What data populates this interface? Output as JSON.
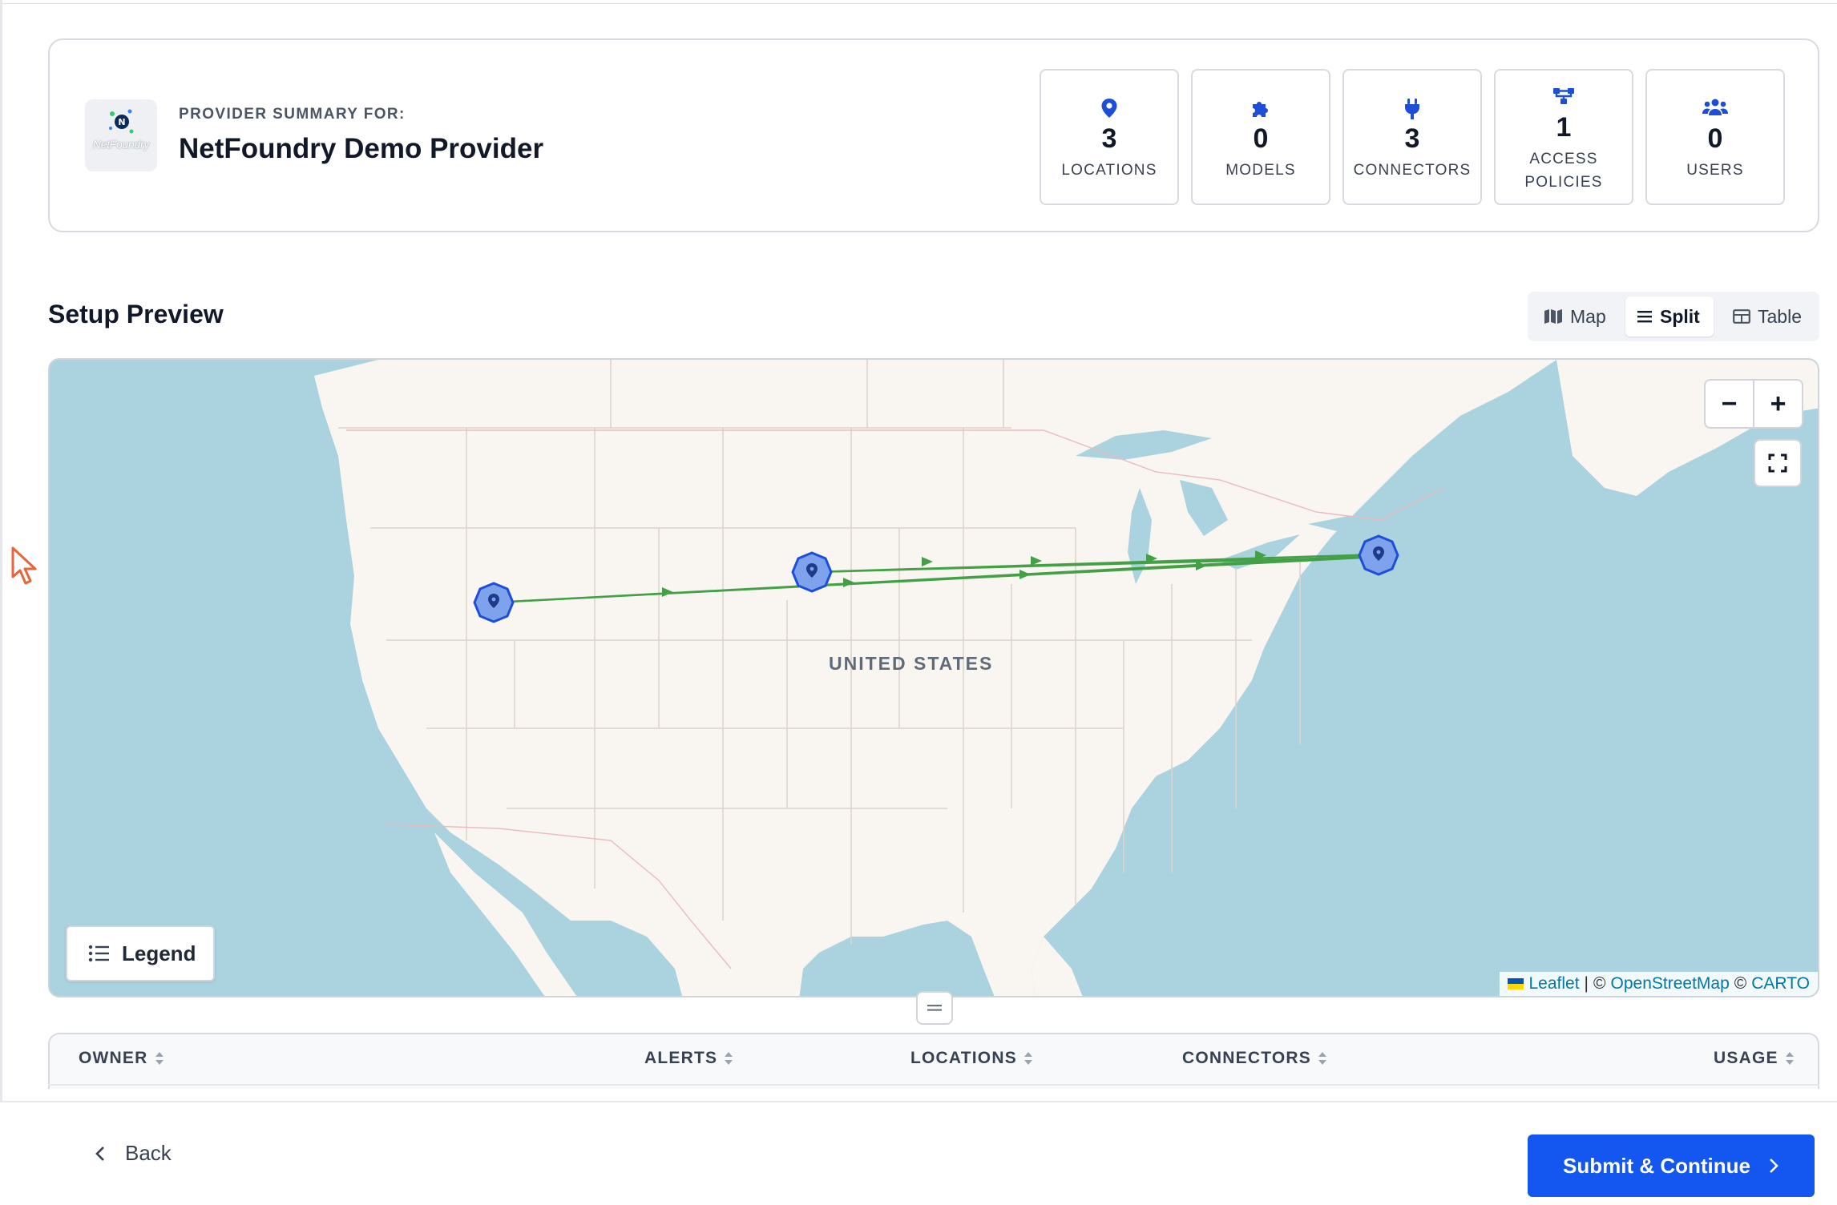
{
  "summary": {
    "label": "PROVIDER SUMMARY FOR:",
    "provider_name": "NetFoundry Demo Provider",
    "logo_text": "NetFoundry",
    "stats": [
      {
        "icon": "map-pin-icon",
        "value": "3",
        "label": "LOCATIONS"
      },
      {
        "icon": "puzzle-icon",
        "value": "0",
        "label": "MODELS"
      },
      {
        "icon": "plug-icon",
        "value": "3",
        "label": "CONNECTORS"
      },
      {
        "icon": "network-icon",
        "value": "1",
        "label": "ACCESS POLICIES"
      },
      {
        "icon": "users-icon",
        "value": "0",
        "label": "USERS"
      }
    ]
  },
  "preview": {
    "title": "Setup Preview",
    "views": [
      {
        "label": "Map",
        "icon": "map-icon",
        "active": false
      },
      {
        "label": "Split",
        "icon": "list-icon",
        "active": true
      },
      {
        "label": "Table",
        "icon": "table-icon",
        "active": false
      }
    ]
  },
  "map": {
    "country_label": "UNITED STATES",
    "zoom_out": "−",
    "zoom_in": "+",
    "legend_label": "Legend",
    "attribution": {
      "leaflet": "Leaflet",
      "sep": "|",
      "copy1": "©",
      "osm": "OpenStreetMap",
      "copy2": "©",
      "carto": "CARTO"
    },
    "colors": {
      "water": "#aad3df",
      "land": "#f9f5f1",
      "marker": "#1d4ed8",
      "route": "#43a047"
    }
  },
  "table": {
    "columns": [
      {
        "label": "OWNER"
      },
      {
        "label": "ALERTS"
      },
      {
        "label": "LOCATIONS"
      },
      {
        "label": "CONNECTORS"
      },
      {
        "label": "USAGE"
      }
    ]
  },
  "footer": {
    "back_label": "Back",
    "submit_label": "Submit & Continue",
    "submit_color": "#1456f0"
  }
}
